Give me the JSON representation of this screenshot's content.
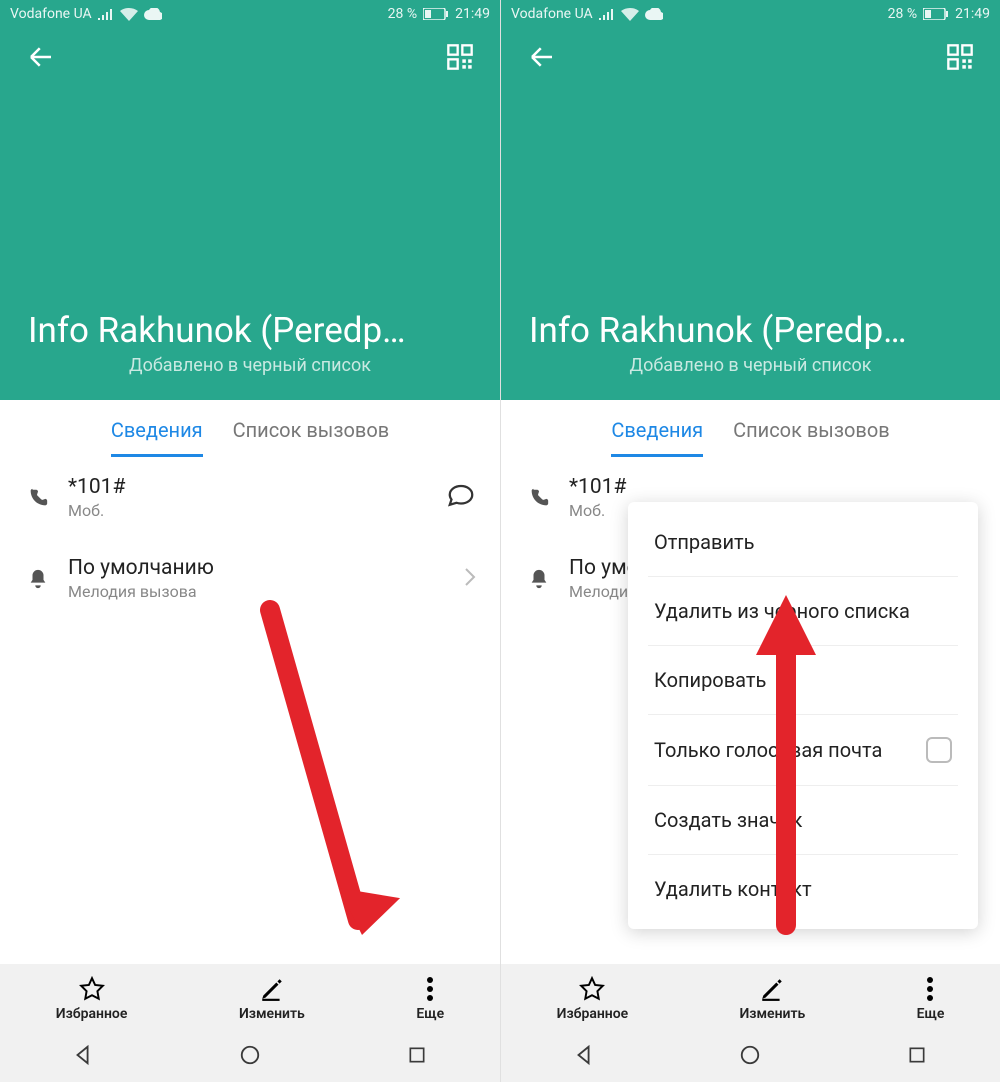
{
  "status": {
    "carrier": "Vodafone UA",
    "battery_pct": "28 %",
    "time": "21:49"
  },
  "header": {
    "contact_name": "Info Rakhunok (Peredp…",
    "subtitle": "Добавлено в черный список"
  },
  "tabs": {
    "details": "Сведения",
    "calls": "Список вызовов"
  },
  "rows": {
    "phone_number": "*101#",
    "phone_type": "Моб.",
    "ringtone_title": "По умолчанию",
    "ringtone_title_trunc": "По умол…",
    "ringtone_sub": "Мелодия вызова",
    "ringtone_sub_trunc": "Мелодия…"
  },
  "bottom": {
    "fav": "Избранное",
    "edit": "Изменить",
    "more": "Еще"
  },
  "popup": {
    "send": "Отправить",
    "remove_blacklist": "Удалить из черного списка",
    "copy": "Копировать",
    "voicemail_only": "Только голосовая почта",
    "create_shortcut": "Создать значок",
    "delete_contact": "Удалить контакт"
  }
}
